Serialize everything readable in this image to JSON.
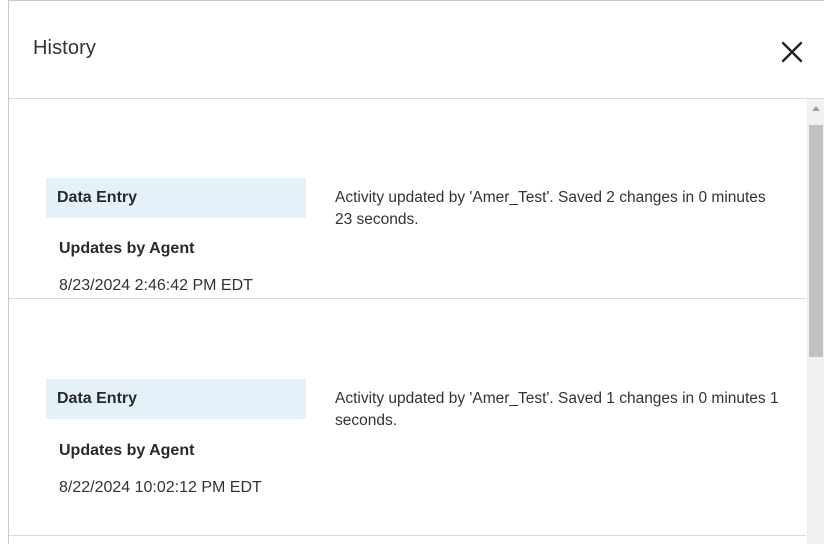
{
  "dialog": {
    "title": "History",
    "close_icon": "close-icon"
  },
  "history": {
    "entries": [
      {
        "type": "Data Entry",
        "subtitle": "Updates by Agent",
        "timestamp": "8/23/2024 2:46:42 PM EDT",
        "description": "Activity updated by 'Amer_Test'. Saved 2 changes in 0 minutes 23 seconds."
      },
      {
        "type": "Data Entry",
        "subtitle": "Updates by Agent",
        "timestamp": "8/22/2024 10:02:12 PM EDT",
        "description": "Activity updated by 'Amer_Test'. Saved 1 changes in 0 minutes 1 seconds."
      }
    ]
  },
  "scrollbar": {
    "up_icon": "chevron-up-icon"
  }
}
